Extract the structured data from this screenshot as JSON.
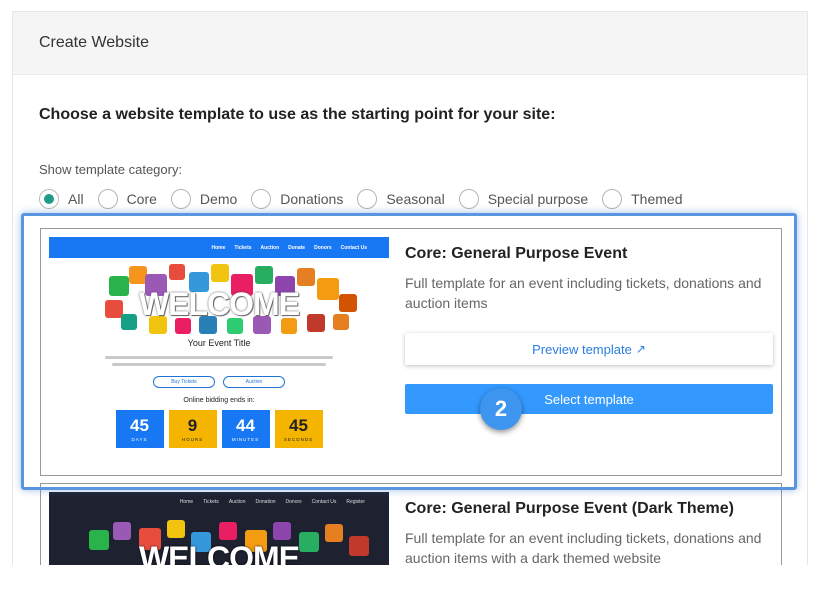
{
  "panel": {
    "title": "Create Website"
  },
  "lead": "Choose a website template to use as the starting point for your site:",
  "category": {
    "label": "Show template category:",
    "options": [
      "All",
      "Core",
      "Demo",
      "Donations",
      "Seasonal",
      "Special purpose",
      "Themed"
    ],
    "selected": "All"
  },
  "templates": [
    {
      "title": "Core: General Purpose Event",
      "description": "Full template for an event including tickets, donations and auction items",
      "preview_label": "Preview template",
      "preview_icon": "external-link-icon",
      "select_label": "Select template",
      "thumbnail": {
        "nav": [
          "Home",
          "Tickets",
          "Auction",
          "Donate",
          "Donors",
          "Contact Us"
        ],
        "welcome": "WELCOME",
        "event_title": "Your Event Title",
        "buttons": [
          "Buy Tickets",
          "Auction"
        ],
        "bidding": "Online bidding ends in:",
        "countdown": [
          {
            "value": "45",
            "unit": "DAYS",
            "color": "#1877f2"
          },
          {
            "value": "9",
            "unit": "HOURS",
            "color": "#f5b400"
          },
          {
            "value": "44",
            "unit": "MINUTES",
            "color": "#1877f2"
          },
          {
            "value": "45",
            "unit": "SECONDS",
            "color": "#f5b400"
          }
        ]
      }
    },
    {
      "title": "Core: General Purpose Event (Dark Theme)",
      "description": "Full template for an event including tickets, donations and auction items with a dark themed website",
      "thumbnail": {
        "nav": [
          "Home",
          "Tickets",
          "Auction",
          "Donation",
          "Donors",
          "Contact Us",
          "Register"
        ],
        "welcome": "WELCOME"
      }
    }
  ],
  "step_badge": "2",
  "colors": {
    "accent": "#3399ff",
    "radio_selected": "#1f9b8a",
    "highlight": "#5a95e0"
  }
}
